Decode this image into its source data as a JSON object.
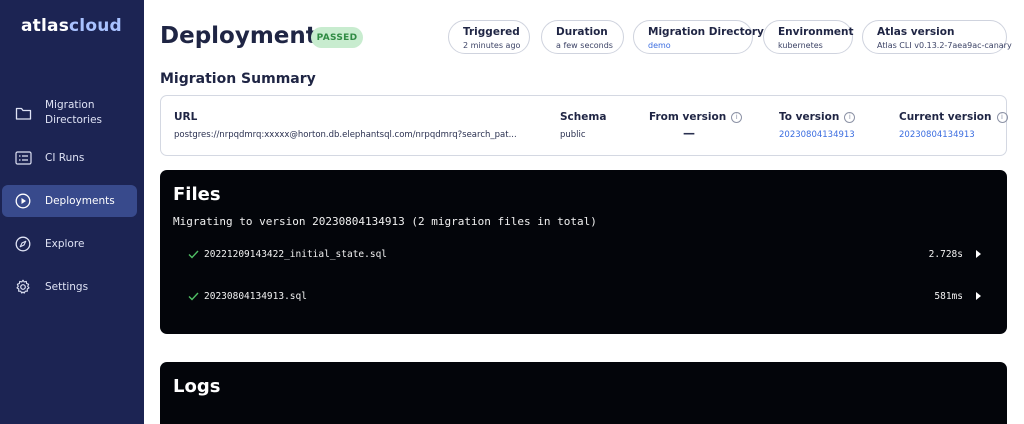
{
  "logo": {
    "part1": "atlas",
    "part2": "cloud"
  },
  "sidebar": {
    "items": [
      {
        "label": "Migration Directories",
        "icon": "folder-icon"
      },
      {
        "label": "CI Runs",
        "icon": "list-card-icon"
      },
      {
        "label": "Deployments",
        "icon": "play-circle-icon",
        "active": true
      },
      {
        "label": "Explore",
        "icon": "compass-icon"
      },
      {
        "label": "Settings",
        "icon": "gear-icon"
      }
    ]
  },
  "header": {
    "title": "Deployment",
    "status": "PASSED",
    "pills": [
      {
        "label": "Triggered",
        "value": "2 minutes ago"
      },
      {
        "label": "Duration",
        "value": "a few seconds"
      },
      {
        "label": "Migration Directory",
        "value": "demo"
      },
      {
        "label": "Environment",
        "value": "kubernetes"
      },
      {
        "label": "Atlas version",
        "value": "Atlas CLI v0.13.2-7aea9ac-canary"
      }
    ]
  },
  "summary": {
    "title": "Migration Summary",
    "url": {
      "label": "URL",
      "value": "postgres://nrpqdmrq:xxxxx@horton.db.elephantsql.com/nrpqdmrq?search_pat..."
    },
    "schema": {
      "label": "Schema",
      "value": "public"
    },
    "from_version": {
      "label": "From version",
      "value": "—"
    },
    "to_version": {
      "label": "To version",
      "value": "20230804134913"
    },
    "current_version": {
      "label": "Current version",
      "value": "20230804134913"
    },
    "info_icon": "i"
  },
  "files": {
    "title": "Files",
    "subtitle": "Migrating to version 20230804134913 (2 migration files in total)",
    "rows": [
      {
        "name": "20221209143422_initial_state.sql",
        "duration": "2.728s"
      },
      {
        "name": "20230804134913.sql",
        "duration": "581ms"
      }
    ]
  },
  "logs": {
    "title": "Logs"
  },
  "colors": {
    "sidebar_bg": "#1c2453",
    "accent_link": "#3b6de0",
    "success": "#2f8b43",
    "panel_bg": "#03050a"
  }
}
